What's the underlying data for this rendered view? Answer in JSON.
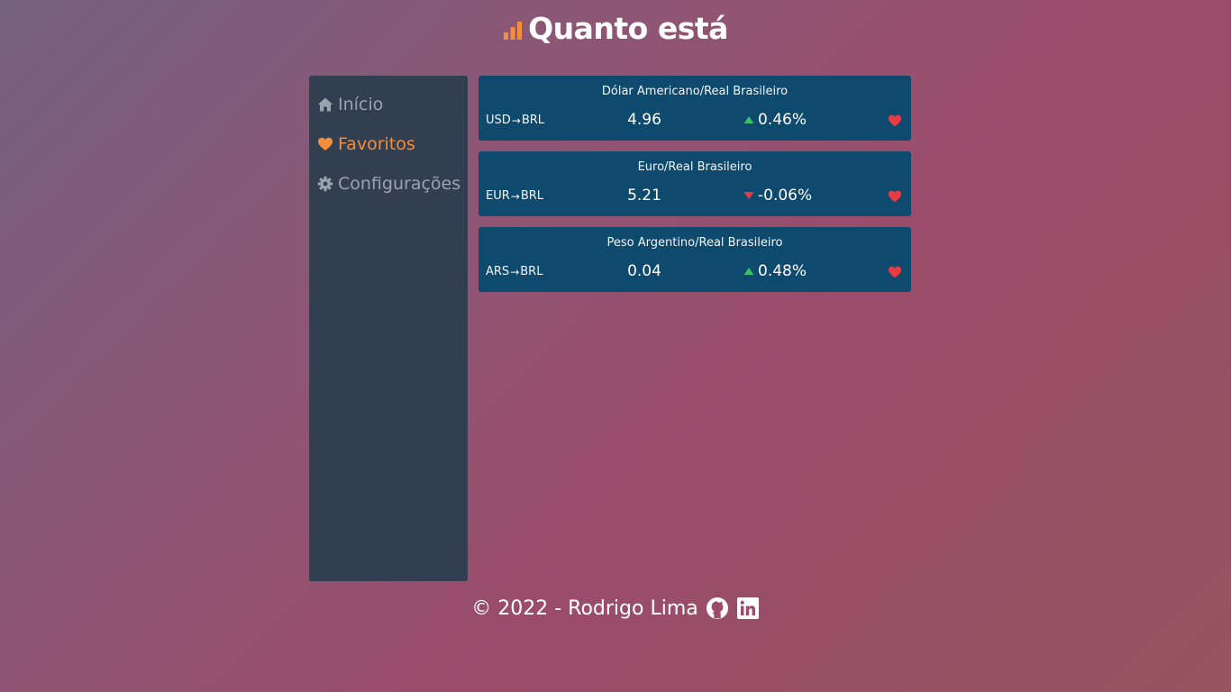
{
  "header": {
    "title": "Quanto está",
    "logo_icon": "bar-chart-icon",
    "logo_color": "#f28e3d"
  },
  "sidebar": {
    "items": [
      {
        "label": "Início",
        "icon": "home-icon",
        "active": false
      },
      {
        "label": "Favoritos",
        "icon": "heart-icon",
        "active": true
      },
      {
        "label": "Configurações",
        "icon": "gear-icon",
        "active": false
      }
    ],
    "active_color": "#f28e3d"
  },
  "currencies": [
    {
      "title": "Dólar Americano/Real Brasileiro",
      "from": "USD",
      "to": "BRL",
      "price": "4.96",
      "change": "0.46%",
      "direction": "up",
      "favorite": true
    },
    {
      "title": "Euro/Real Brasileiro",
      "from": "EUR",
      "to": "BRL",
      "price": "5.21",
      "change": "-0.06%",
      "direction": "down",
      "favorite": true
    },
    {
      "title": "Peso Argentino/Real Brasileiro",
      "from": "ARS",
      "to": "BRL",
      "price": "0.04",
      "change": "0.48%",
      "direction": "up",
      "favorite": true
    }
  ],
  "colors": {
    "up": "#3dbe6c",
    "down": "#e83c44",
    "favorite": "#e83c44",
    "card_bg": "#0d4a6d",
    "sidebar_bg": "#323f51"
  },
  "footer": {
    "text": "© 2022 - Rodrigo Lima",
    "links": [
      {
        "icon": "github-icon"
      },
      {
        "icon": "linkedin-icon"
      }
    ]
  }
}
